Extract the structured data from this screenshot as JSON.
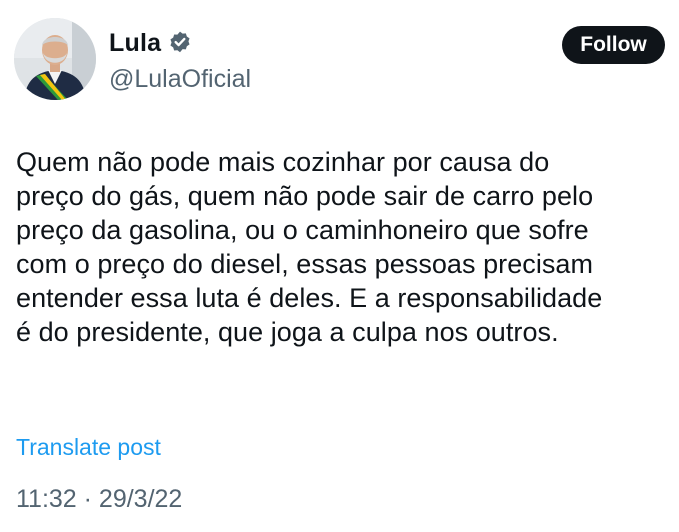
{
  "author": {
    "display_name": "Lula",
    "handle": "@LulaOficial",
    "verified_icon": "verified-badge-icon",
    "verified_color": "#536471"
  },
  "follow_button": {
    "label": "Follow"
  },
  "post": {
    "text": "Quem não pode mais cozinhar por causa do\npreço do gás, quem não pode sair de carro pelo\npreço da gasolina, ou o caminhoneiro que sofre\ncom o preço do diesel, essas pessoas precisam\nentender essa luta é deles. E a responsabilidade\né do presidente, que joga a culpa nos outros.",
    "translate_label": "Translate post",
    "timestamp": "11:32 · 29/3/22"
  },
  "colors": {
    "link": "#1d9bf0",
    "secondary_text": "#536471",
    "primary_text": "#0f1419"
  }
}
